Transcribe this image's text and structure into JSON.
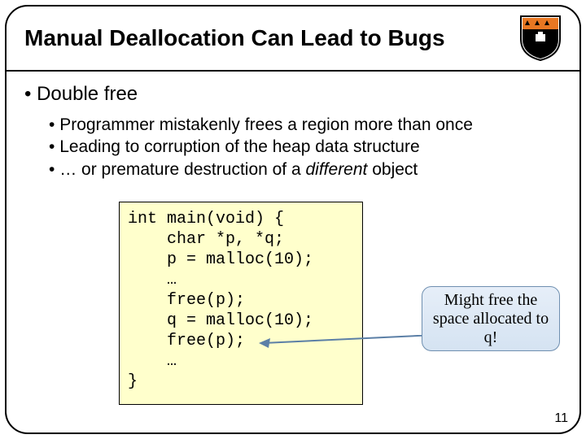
{
  "title": "Manual Deallocation Can Lead to Bugs",
  "bullets": {
    "main": "Double free",
    "sub": [
      "Programmer mistakenly frees a region more than once",
      "Leading to corruption of the heap data structure",
      "… or premature destruction of a "
    ],
    "sub_italic_tail": "different",
    "sub_tail_after": " object"
  },
  "code": "int main(void) {\n    char *p, *q;\n    p = malloc(10);\n    …\n    free(p);\n    q = malloc(10);\n    free(p);\n    …\n}",
  "callout": "Might free the space allocated to q!",
  "slide_number": "11",
  "logo_alt": "princeton-shield"
}
